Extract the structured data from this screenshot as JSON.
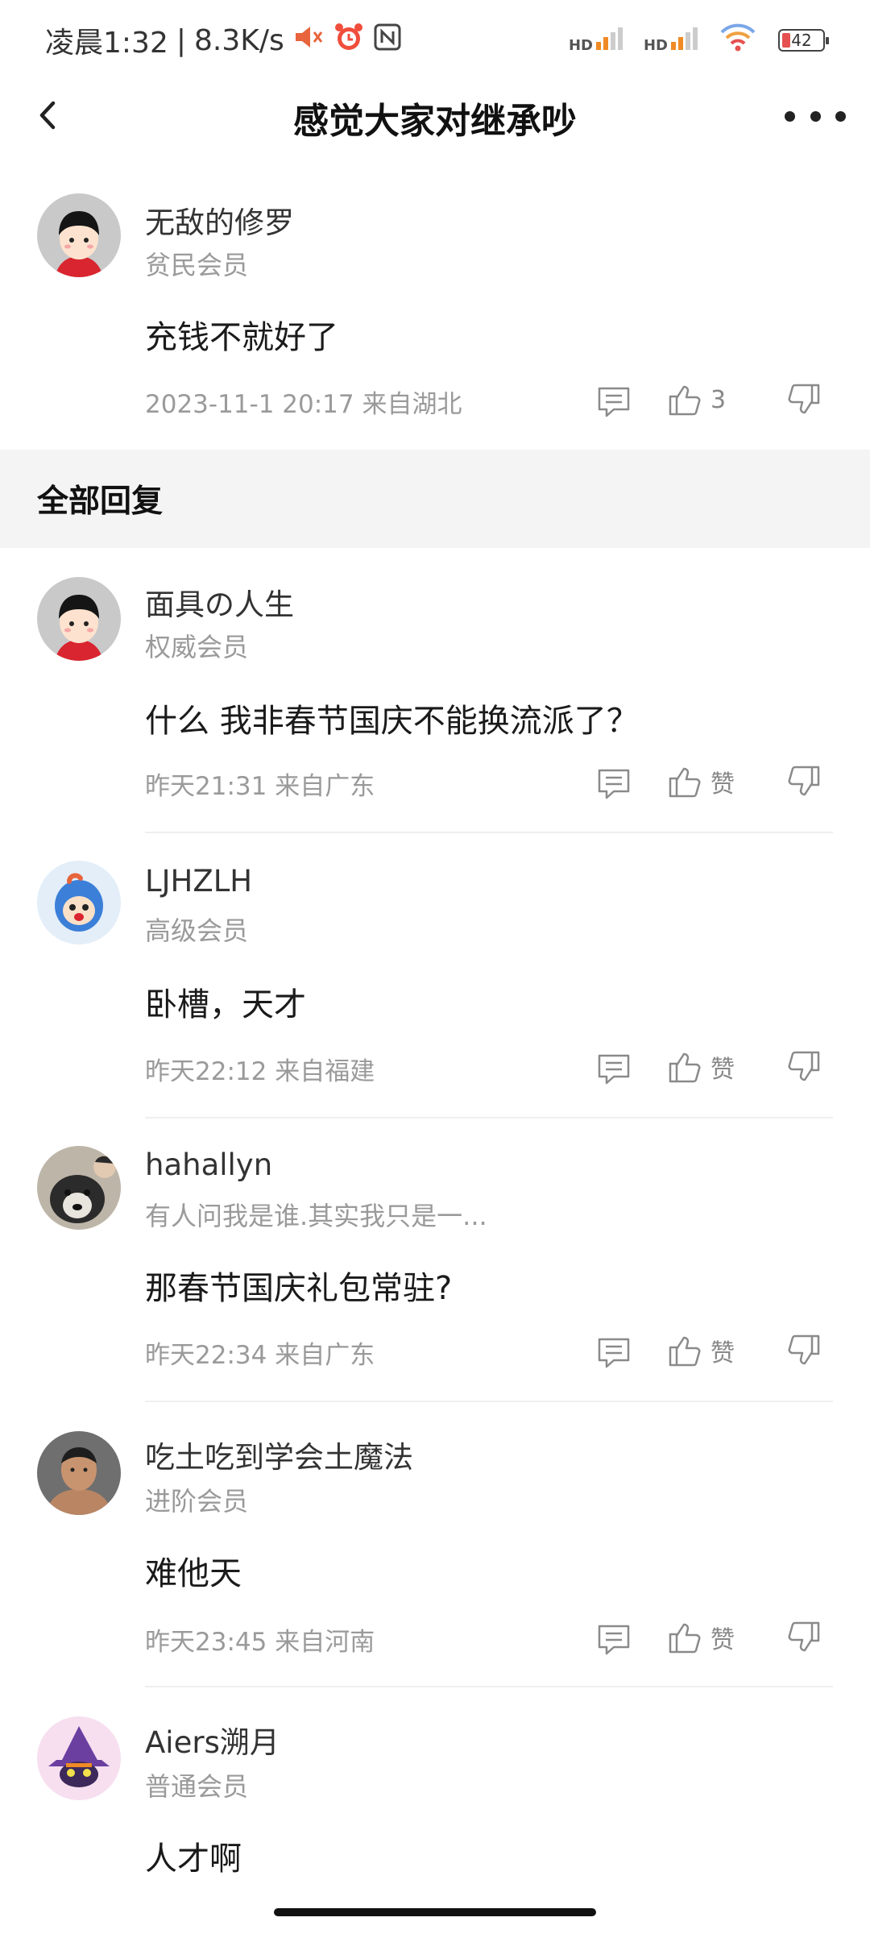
{
  "status_bar": {
    "time": "凌晨1:32",
    "speed": "8.3K/s",
    "separator": "|",
    "hd1": "HD",
    "hd2": "HD",
    "battery": "42"
  },
  "nav": {
    "title": "感觉大家对继承吵"
  },
  "main_comment": {
    "username": "无敌的修罗",
    "level": "贫民会员",
    "content": "充钱不就好了",
    "meta": "2023-11-1 20:17  来自湖北",
    "likes": "3"
  },
  "section": {
    "title": "全部回复"
  },
  "replies": [
    {
      "username": "面具の人生",
      "level": "权威会员",
      "content": "什么 我非春节国庆不能换流派了？",
      "meta": "昨天21:31 来自广东",
      "likes": "赞"
    },
    {
      "username": "LJHZLH",
      "level": "高级会员",
      "content": "卧槽，天才",
      "meta": "昨天22:12 来自福建",
      "likes": "赞"
    },
    {
      "username": "hahallyn",
      "level": "有人问我是谁.其实我只是一...",
      "content": "那春节国庆礼包常驻?",
      "meta": "昨天22:34 来自广东",
      "likes": "赞"
    },
    {
      "username": "吃土吃到学会土魔法",
      "level": "进阶会员",
      "content": "难他天",
      "meta": "昨天23:45 来自河南",
      "likes": "赞"
    },
    {
      "username": "Aiers溯月",
      "level": "普通会员",
      "content": "人才啊",
      "meta": "",
      "likes": ""
    }
  ]
}
